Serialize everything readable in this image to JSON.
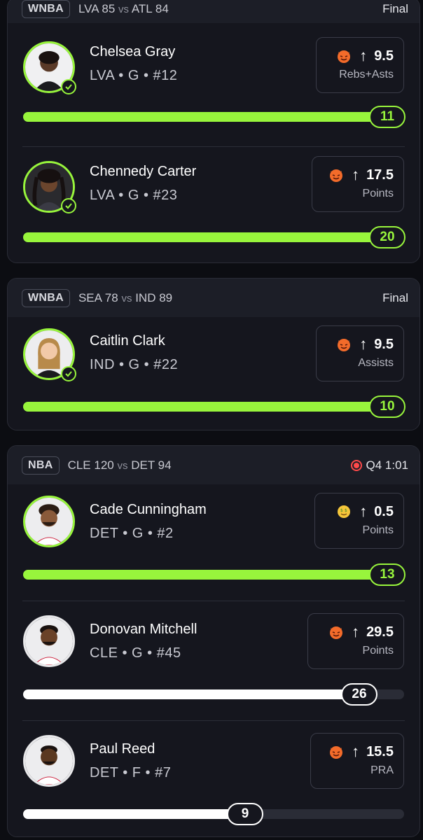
{
  "colors": {
    "hit": "#98f53c",
    "neutral": "#ffffff",
    "live": "#ff4a4a"
  },
  "cards": [
    {
      "league": "WNBA",
      "away_team": "LVA",
      "away_score": "85",
      "vs": "vs",
      "home_team": "ATL",
      "home_score": "84",
      "status": "Final",
      "live": false,
      "players": [
        {
          "name": "Chelsea Gray",
          "meta": "LVA • G • #12",
          "icon": "devil-emoji",
          "arrow": "↑",
          "line": "9.5",
          "stat": "Rebs+Asts",
          "actual": "11",
          "progress": 1.0,
          "hit": true
        },
        {
          "name": "Chennedy Carter",
          "meta": "LVA • G • #23",
          "icon": "devil-emoji",
          "arrow": "↑",
          "line": "17.5",
          "stat": "Points",
          "actual": "20",
          "progress": 1.0,
          "hit": true
        }
      ]
    },
    {
      "league": "WNBA",
      "away_team": "SEA",
      "away_score": "78",
      "vs": "vs",
      "home_team": "IND",
      "home_score": "89",
      "status": "Final",
      "live": false,
      "players": [
        {
          "name": "Caitlin Clark",
          "meta": "IND • G • #22",
          "icon": "devil-emoji",
          "arrow": "↑",
          "line": "9.5",
          "stat": "Assists",
          "actual": "10",
          "progress": 1.0,
          "hit": true
        }
      ]
    },
    {
      "league": "NBA",
      "away_team": "CLE",
      "away_score": "120",
      "vs": "vs",
      "home_team": "DET",
      "home_score": "94",
      "status": "Q4 1:01",
      "live": true,
      "players": [
        {
          "name": "Cade Cunningham",
          "meta": "DET • G • #2",
          "icon": "money-face-emoji",
          "arrow": "↑",
          "line": "0.5",
          "stat": "Points",
          "actual": "13",
          "progress": 1.0,
          "hit": true
        },
        {
          "name": "Donovan Mitchell",
          "meta": "CLE • G • #45",
          "icon": "devil-emoji",
          "arrow": "↑",
          "line": "29.5",
          "stat": "Points",
          "actual": "26",
          "progress": 0.88,
          "hit": false
        },
        {
          "name": "Paul Reed",
          "meta": "DET • F • #7",
          "icon": "devil-emoji",
          "arrow": "↑",
          "line": "15.5",
          "stat": "PRA",
          "actual": "9",
          "progress": 0.58,
          "hit": false
        }
      ]
    }
  ]
}
